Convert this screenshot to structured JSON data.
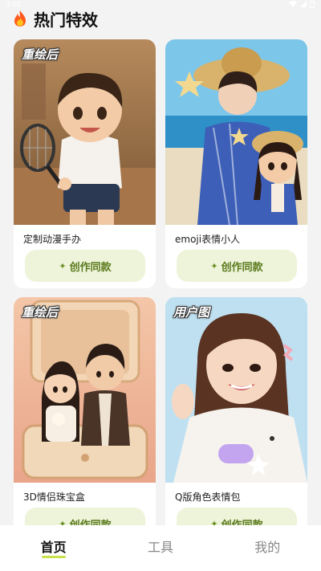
{
  "status_bar": {
    "time": "3:51"
  },
  "header": {
    "title": "热门特效"
  },
  "cards": [
    {
      "badge": "重绘后",
      "caption": "定制动漫手办",
      "button_label": "创作同款"
    },
    {
      "badge": "",
      "caption": "emoji表情小人",
      "button_label": "创作同款"
    },
    {
      "badge": "重绘后",
      "caption": "3D情侣珠宝盒",
      "button_label": "创作同款"
    },
    {
      "badge": "用户图",
      "caption": "Q版角色表情包",
      "button_label": "创作同款"
    }
  ],
  "tabbar": {
    "tabs": [
      {
        "label": "首页",
        "active": true
      },
      {
        "label": "工具",
        "active": false
      },
      {
        "label": "我的",
        "active": false
      }
    ]
  },
  "colors": {
    "accent": "#c8e24a",
    "button_bg": "#eef4d9",
    "button_text": "#5b7a1e"
  }
}
